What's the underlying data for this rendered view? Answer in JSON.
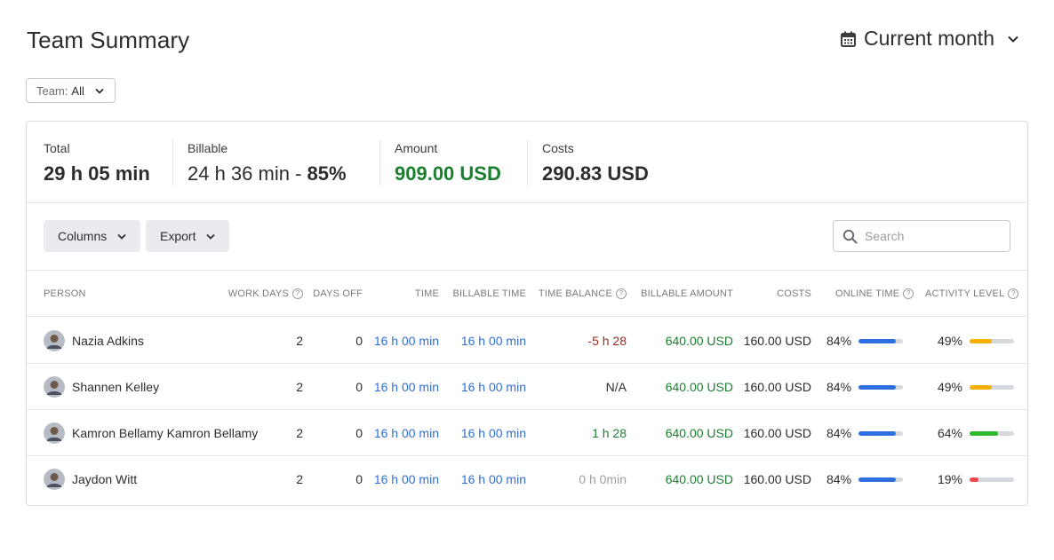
{
  "header": {
    "title": "Team Summary",
    "period": "Current month"
  },
  "filter": {
    "label": "Team:",
    "value": "All"
  },
  "stats": {
    "total": {
      "label": "Total",
      "value": "29 h 05 min"
    },
    "billable": {
      "label": "Billable",
      "value": "24 h 36 min - ",
      "percent": "85%"
    },
    "amount": {
      "label": "Amount",
      "value": "909.00 USD"
    },
    "costs": {
      "label": "Costs",
      "value": "290.83 USD"
    }
  },
  "toolbar": {
    "columns_label": "Columns",
    "export_label": "Export",
    "search_placeholder": "Search"
  },
  "columns": {
    "person": "PERSON",
    "work_days": "WORK DAYS",
    "days_off": "DAYS OFF",
    "time": "TIME",
    "billable_time": "BILLABLE TIME",
    "time_balance": "TIME BALANCE",
    "billable_amount": "BILLABLE AMOUNT",
    "costs": "COSTS",
    "online_time": "ONLINE TIME",
    "activity_level": "ACTIVITY LEVEL"
  },
  "rows": [
    {
      "name": "Nazia Adkins",
      "work_days": "2",
      "days_off": "0",
      "time": "16 h 00 min",
      "billable_time": "16 h 00 min",
      "time_balance": "-5 h 28",
      "balance_state": "negative",
      "billable_amount": "640.00 USD",
      "costs": "160.00 USD",
      "online_time": "84%",
      "online_fraction": 0.84,
      "activity_level": "49%",
      "activity_fraction": 0.49,
      "activity_color": "#f5b000"
    },
    {
      "name": "Shannen Kelley",
      "work_days": "2",
      "days_off": "0",
      "time": "16 h 00 min",
      "billable_time": "16 h 00 min",
      "time_balance": "N/A",
      "balance_state": "na",
      "billable_amount": "640.00 USD",
      "costs": "160.00 USD",
      "online_time": "84%",
      "online_fraction": 0.84,
      "activity_level": "49%",
      "activity_fraction": 0.49,
      "activity_color": "#f5b000"
    },
    {
      "name": "Kamron Bellamy Kamron Bellamy",
      "work_days": "2",
      "days_off": "0",
      "time": "16 h 00 min",
      "billable_time": "16 h 00 min",
      "time_balance": "1 h 28",
      "balance_state": "positive",
      "billable_amount": "640.00 USD",
      "costs": "160.00 USD",
      "online_time": "84%",
      "online_fraction": 0.84,
      "activity_level": "64%",
      "activity_fraction": 0.64,
      "activity_color": "#2db82d"
    },
    {
      "name": "Jaydon Witt",
      "work_days": "2",
      "days_off": "0",
      "time": "16 h 00 min",
      "billable_time": "16 h 00 min",
      "time_balance": "0 h 0min",
      "balance_state": "zero",
      "billable_amount": "640.00 USD",
      "costs": "160.00 USD",
      "online_time": "84%",
      "online_fraction": 0.84,
      "activity_level": "19%",
      "activity_fraction": 0.19,
      "activity_color": "#f04848"
    }
  ],
  "colors": {
    "link_blue": "#2f6fd6",
    "amount_green": "#1a7f2e",
    "negative_red": "#9c2b1f",
    "online_bar": "#2f6fe0"
  }
}
